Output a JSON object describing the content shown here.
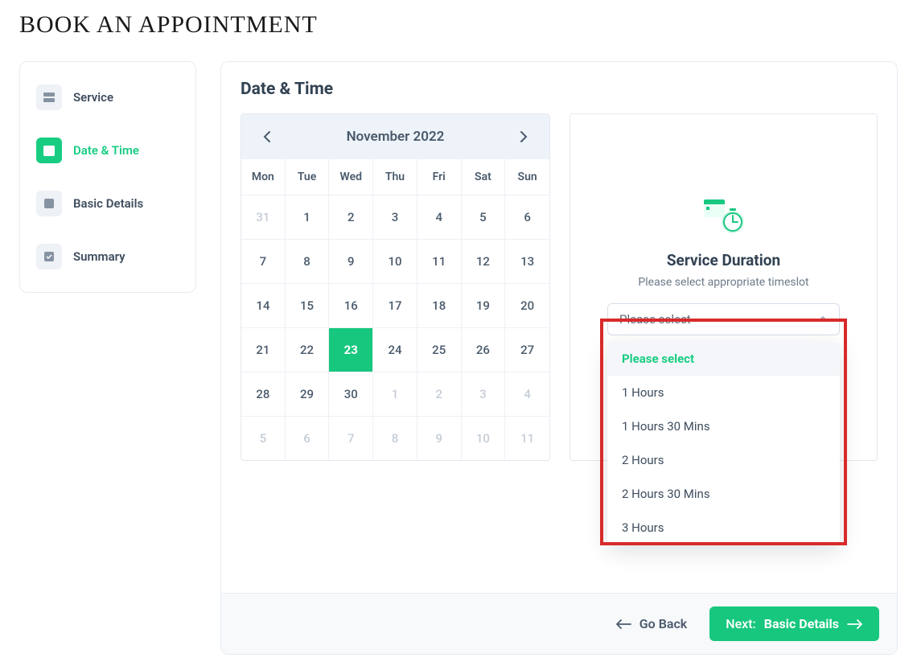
{
  "page_title": "BOOK AN APPOINTMENT",
  "sidebar": {
    "steps": [
      {
        "label": "Service",
        "active": false
      },
      {
        "label": "Date & Time",
        "active": true
      },
      {
        "label": "Basic Details",
        "active": false
      },
      {
        "label": "Summary",
        "active": false
      }
    ]
  },
  "section_title": "Date & Time",
  "calendar": {
    "month_label": "November 2022",
    "dow": [
      "Mon",
      "Tue",
      "Wed",
      "Thu",
      "Fri",
      "Sat",
      "Sun"
    ],
    "cells": [
      {
        "d": "31",
        "other": true
      },
      {
        "d": "1"
      },
      {
        "d": "2"
      },
      {
        "d": "3"
      },
      {
        "d": "4"
      },
      {
        "d": "5"
      },
      {
        "d": "6"
      },
      {
        "d": "7"
      },
      {
        "d": "8"
      },
      {
        "d": "9"
      },
      {
        "d": "10"
      },
      {
        "d": "11"
      },
      {
        "d": "12"
      },
      {
        "d": "13"
      },
      {
        "d": "14"
      },
      {
        "d": "15"
      },
      {
        "d": "16"
      },
      {
        "d": "17"
      },
      {
        "d": "18"
      },
      {
        "d": "19"
      },
      {
        "d": "20"
      },
      {
        "d": "21"
      },
      {
        "d": "22"
      },
      {
        "d": "23",
        "selected": true
      },
      {
        "d": "24"
      },
      {
        "d": "25"
      },
      {
        "d": "26"
      },
      {
        "d": "27"
      },
      {
        "d": "28"
      },
      {
        "d": "29"
      },
      {
        "d": "30"
      },
      {
        "d": "1",
        "other": true
      },
      {
        "d": "2",
        "other": true
      },
      {
        "d": "3",
        "other": true
      },
      {
        "d": "4",
        "other": true
      },
      {
        "d": "5",
        "other": true
      },
      {
        "d": "6",
        "other": true
      },
      {
        "d": "7",
        "other": true
      },
      {
        "d": "8",
        "other": true
      },
      {
        "d": "9",
        "other": true
      },
      {
        "d": "10",
        "other": true
      },
      {
        "d": "11",
        "other": true
      }
    ]
  },
  "duration": {
    "title": "Service Duration",
    "subtitle": "Please select appropriate timeslot",
    "selected": "Please select",
    "options": [
      "Please select",
      "1 Hours",
      "1 Hours 30 Mins",
      "2 Hours",
      "2 Hours 30 Mins",
      "3 Hours"
    ]
  },
  "footer": {
    "back_label": "Go Back",
    "next_prefix": "Next:",
    "next_label": "Basic Details"
  },
  "colors": {
    "accent": "#17c77e"
  }
}
